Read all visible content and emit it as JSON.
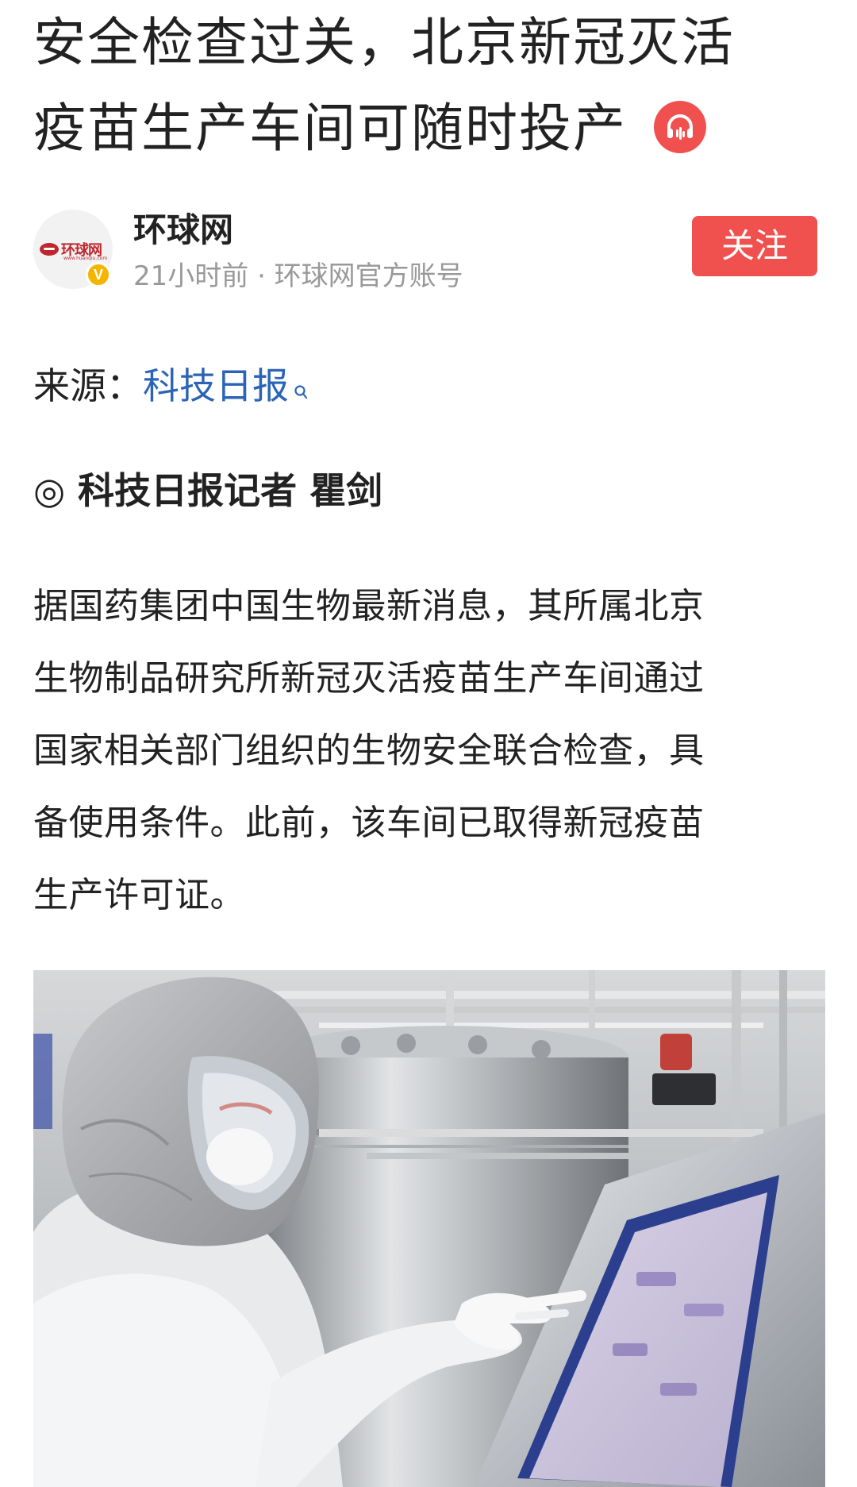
{
  "article": {
    "title_lines": [
      "安全检查过关，北京新冠灭活",
      "疫苗生产车间可随时投产"
    ],
    "listen_icon": "headphones-icon"
  },
  "author": {
    "name": "环球网",
    "meta": "21小时前 · 环球网官方账号",
    "avatar_logo_text": "环球网",
    "avatar_logo_sub": "www.huanqiu.com",
    "verified_badge": "V",
    "follow_label": "关注"
  },
  "source": {
    "label": "来源：",
    "link_text": "科技日报"
  },
  "byline": "◎ 科技日报记者 瞿剑",
  "paragraph_lines": [
    "据国药集团中国生物最新消息，其所属北京",
    "生物制品研究所新冠灭活疫苗生产车间通过",
    "国家相关部门组织的生物安全联合检查，具",
    "备使用条件。此前，该车间已取得新冠疫苗",
    "生产许可证。"
  ],
  "colors": {
    "accent": "#f0514f",
    "link": "#2b64b6",
    "muted": "#999999",
    "text": "#222222",
    "verified": "#f5b400",
    "logo": "#c0262d"
  }
}
